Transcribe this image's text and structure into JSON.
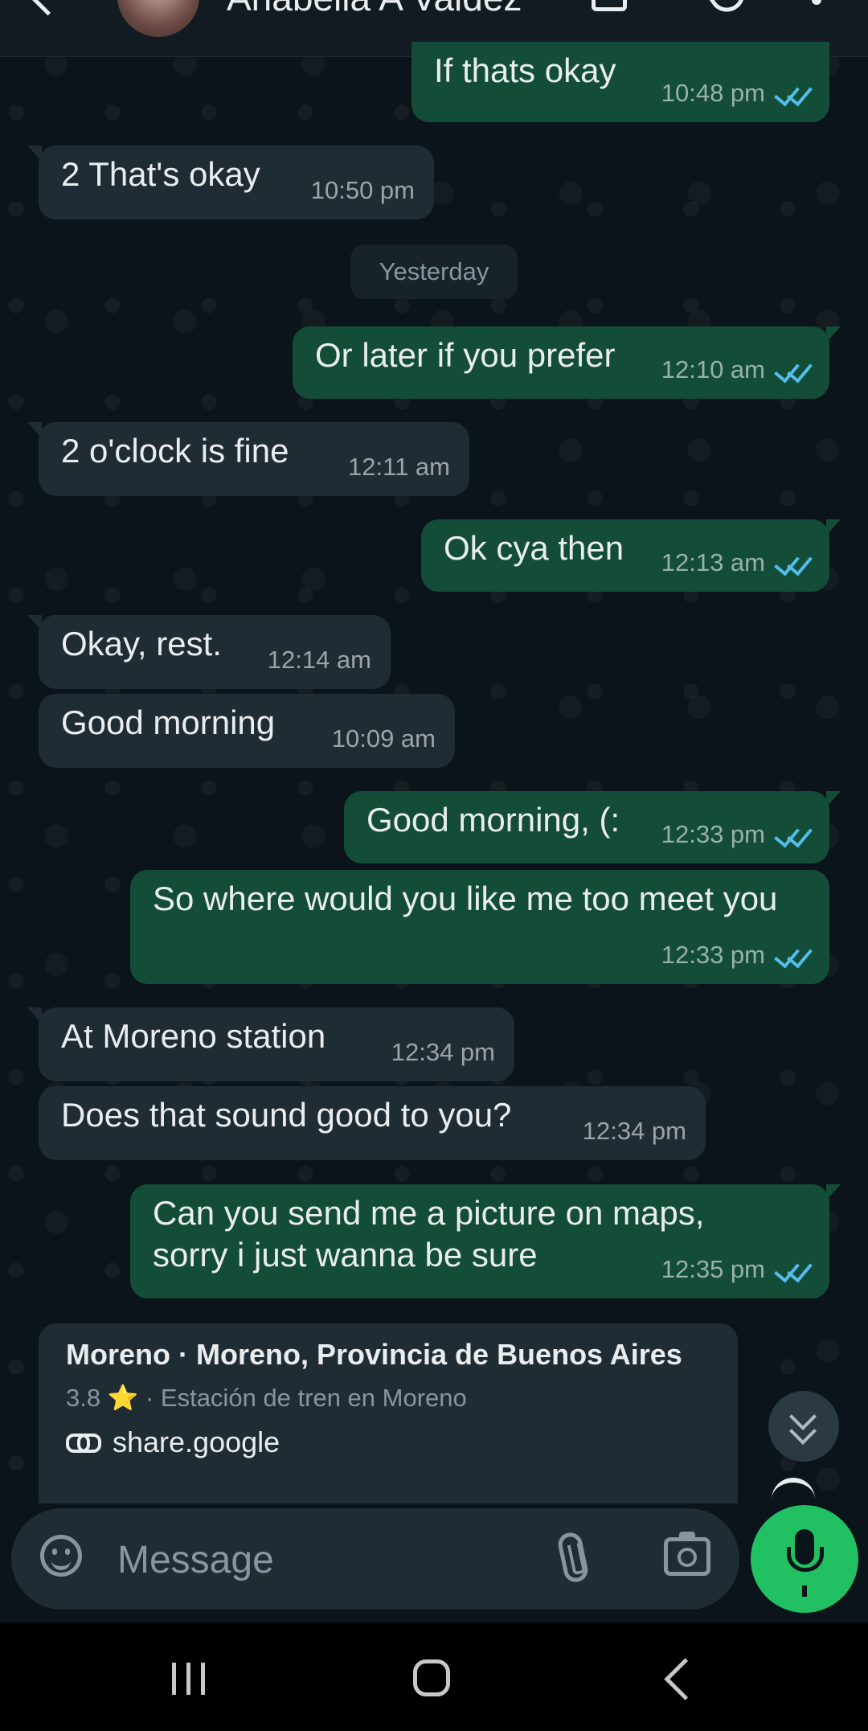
{
  "header": {
    "contact_name": "Anabella A Valdez",
    "icons": [
      "back-arrow-icon",
      "avatar",
      "video-call-icon",
      "voice-call-icon",
      "more-vert-icon"
    ]
  },
  "date_separator": "Yesterday",
  "messages": [
    {
      "direction": "out",
      "text": "If thats okay",
      "time": "10:48 pm",
      "status": "read"
    },
    {
      "direction": "in",
      "text": "2 That's okay",
      "time": "10:50 pm"
    },
    {
      "direction": "out",
      "text": "Or later if you prefer",
      "time": "12:10 am",
      "status": "read"
    },
    {
      "direction": "in",
      "text": "2 o'clock is fine",
      "time": "12:11 am"
    },
    {
      "direction": "out",
      "text": "Ok cya then",
      "time": "12:13 am",
      "status": "read"
    },
    {
      "direction": "in",
      "text": "Okay, rest.",
      "time": "12:14 am"
    },
    {
      "direction": "in",
      "text": "Good morning",
      "time": "10:09 am"
    },
    {
      "direction": "out",
      "text": "Good morning, (:",
      "time": "12:33 pm",
      "status": "read"
    },
    {
      "direction": "out",
      "text": "So where would you like me too meet you",
      "time": "12:33 pm",
      "status": "read"
    },
    {
      "direction": "in",
      "text": "At Moreno station",
      "time": "12:34 pm"
    },
    {
      "direction": "in",
      "text": "Does that sound good to you?",
      "time": "12:34 pm"
    },
    {
      "direction": "out",
      "text": "Can you send me a picture on maps, sorry i just wanna be sure",
      "time": "12:35 pm",
      "status": "read"
    }
  ],
  "link_card": {
    "title": "Moreno · Moreno, Provincia de Buenos Aires",
    "rating": "3.8",
    "rating_star": "⭐",
    "subtitle": "· Estación de tren en Moreno",
    "link": "share.google"
  },
  "composer": {
    "placeholder": "Message"
  },
  "colors": {
    "background": "#0b141a",
    "incoming_bubble": "#202c33",
    "outgoing_bubble": "#134d37",
    "read_ticks": "#53bdeb",
    "mic_button": "#21c063"
  }
}
